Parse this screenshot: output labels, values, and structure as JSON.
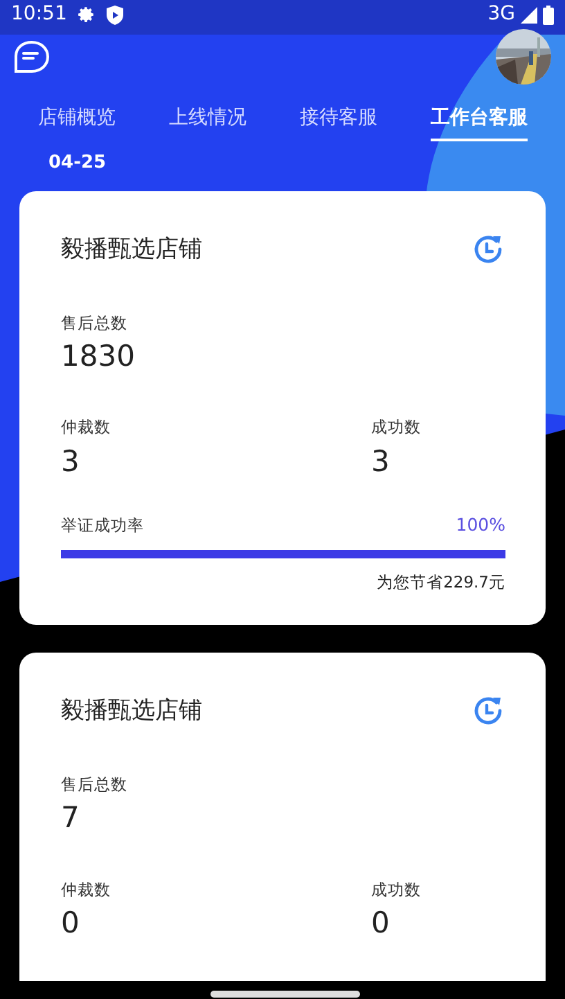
{
  "status_bar": {
    "time": "10:51",
    "network": "3G"
  },
  "tabs": [
    {
      "label": "店铺概览",
      "selected": false
    },
    {
      "label": "上线情况",
      "selected": false
    },
    {
      "label": "接待客服",
      "selected": false
    },
    {
      "label": "工作台客服",
      "selected": true
    }
  ],
  "date": "04-25",
  "stores": [
    {
      "name": "毅播甄选店铺",
      "total_label": "售后总数",
      "total": "1830",
      "arbitration_label": "仲裁数",
      "arbitration": "3",
      "success_label": "成功数",
      "success": "3",
      "rate": {
        "label": "举证成功率",
        "value": "100%",
        "level": 1.0,
        "savings": "为您节省229.7元"
      }
    },
    {
      "name": "毅播甄选店铺",
      "total_label": "售后总数",
      "total": "7",
      "arbitration_label": "仲裁数",
      "arbitration": "0",
      "success_label": "成功数",
      "success": "0"
    }
  ]
}
